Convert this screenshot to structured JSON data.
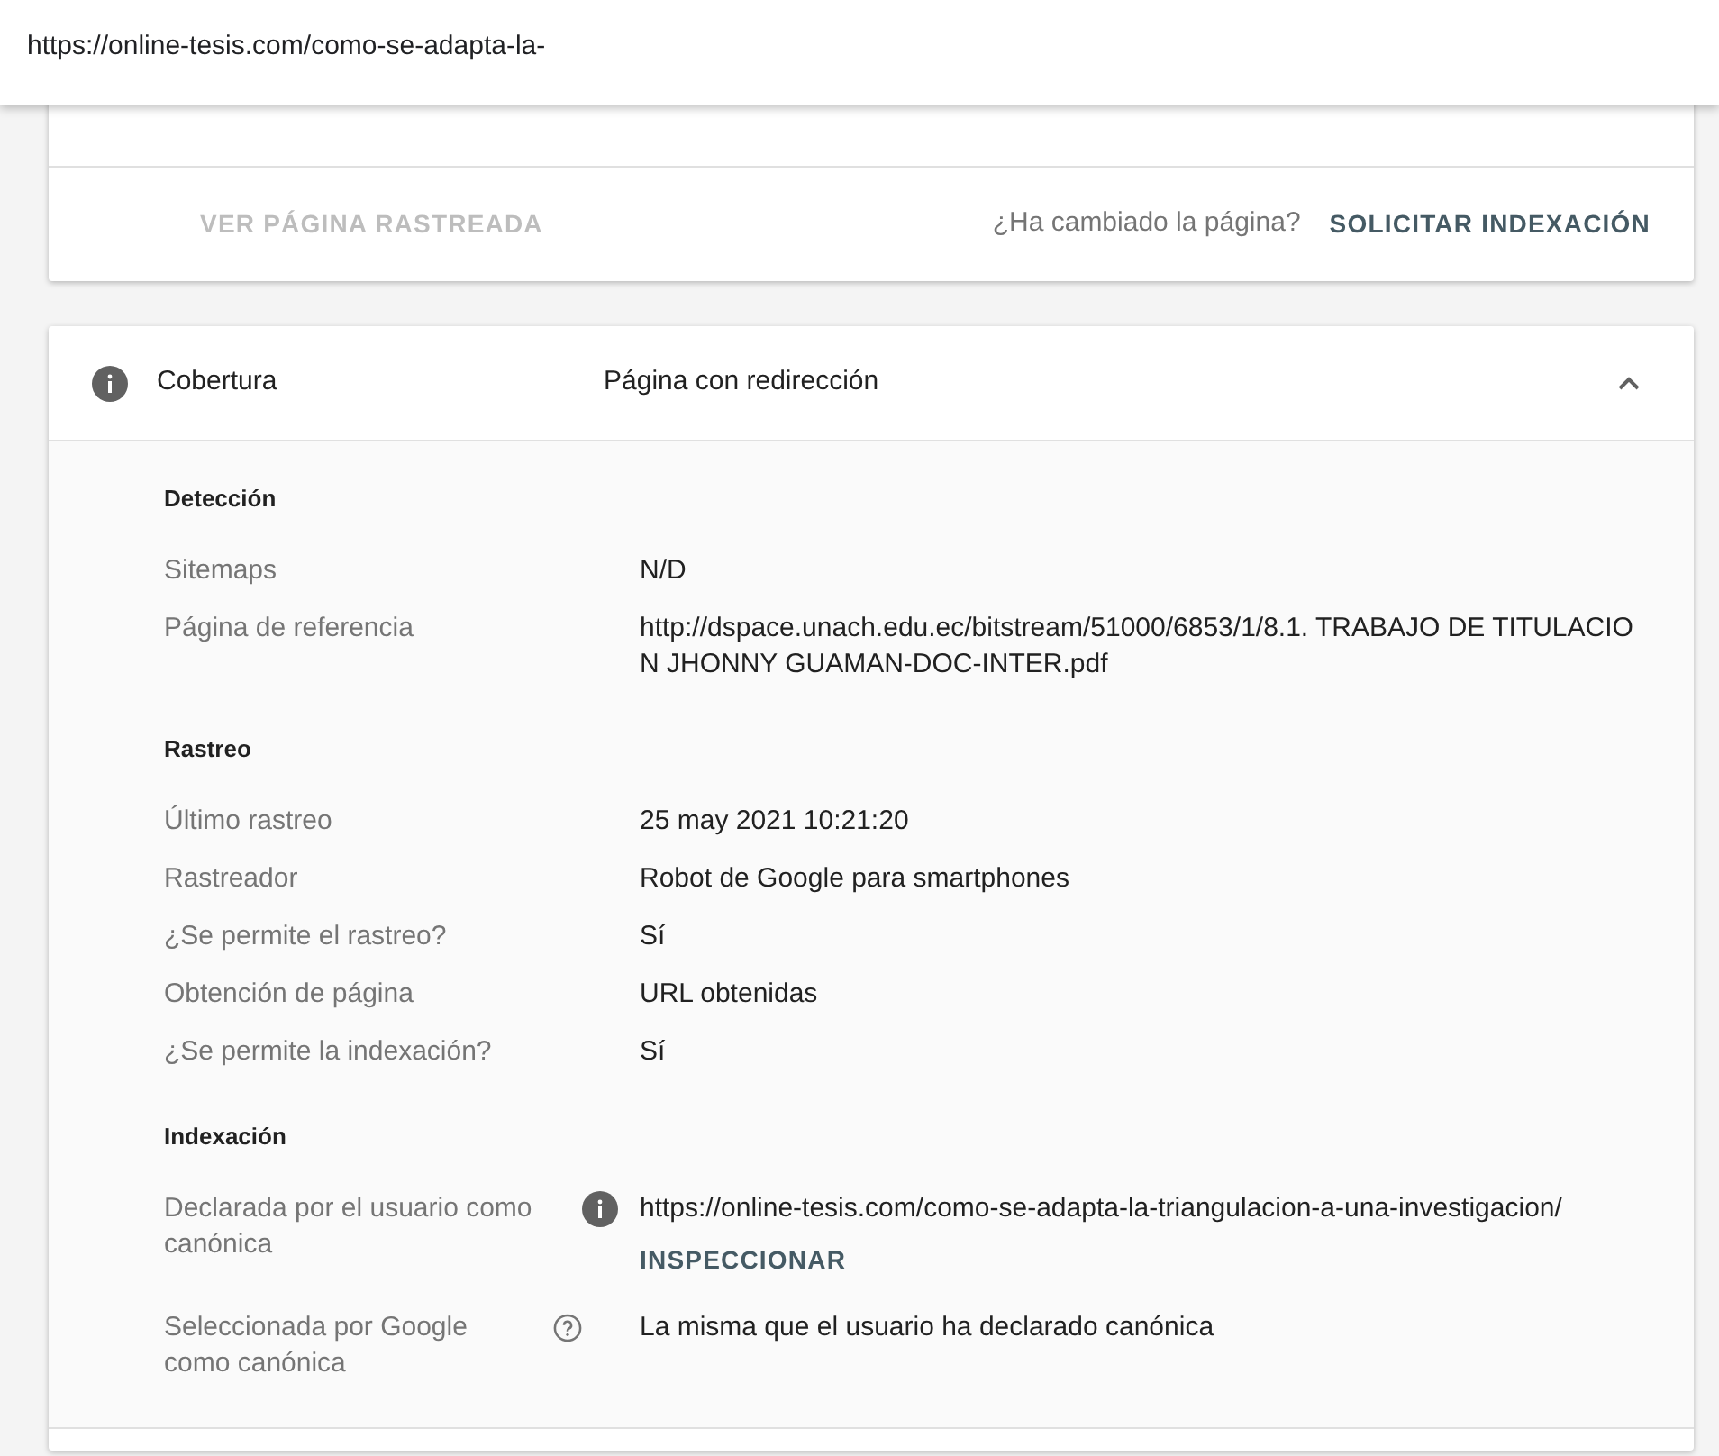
{
  "address_bar": {
    "url": "https://online-tesis.com/como-se-adapta-la-"
  },
  "request_card": {
    "view_button": {
      "label": "VER PÁGINA RASTREADA",
      "disabled": true
    },
    "question": "¿Ha cambiado la página?",
    "request_button": "SOLICITAR INDEXACIÓN"
  },
  "coverage": {
    "title": "Cobertura",
    "status": "Página con redirección",
    "expanded": true,
    "sections": [
      {
        "heading": "Detección",
        "rows": [
          {
            "kind": "plain",
            "label": "Sitemaps",
            "value": "N/D"
          },
          {
            "kind": "plain",
            "label": "Página de referencia",
            "value": "http://dspace.unach.edu.ec/bitstream/51000/6853/1/8.1. TRABAJO DE TITULACIO N JHONNY GUAMAN-DOC-INTER.pdf"
          }
        ]
      },
      {
        "heading": "Rastreo",
        "rows": [
          {
            "kind": "plain",
            "label": "Último rastreo",
            "value": "25 may 2021 10:21:20"
          },
          {
            "kind": "plain",
            "label": "Rastreador",
            "value": "Robot de Google para smartphones"
          },
          {
            "kind": "plain",
            "label": "¿Se permite el rastreo?",
            "value": "Sí"
          },
          {
            "kind": "plain",
            "label": "Obtención de página",
            "value": "URL obtenidas"
          },
          {
            "kind": "plain",
            "label": "¿Se permite la indexación?",
            "value": "Sí"
          }
        ]
      },
      {
        "heading": "Indexación",
        "rows": [
          {
            "kind": "info",
            "label": "Declarada por el usuario como canónica",
            "value": "https://online-tesis.com/como-se-adapta-la-triangulacion-a-una-investigacion/",
            "action": "INSPECCIONAR"
          },
          {
            "kind": "question",
            "label": "Seleccionada por Google como canónica",
            "value": "La misma que el usuario ha declarado canónica"
          }
        ]
      }
    ]
  }
}
